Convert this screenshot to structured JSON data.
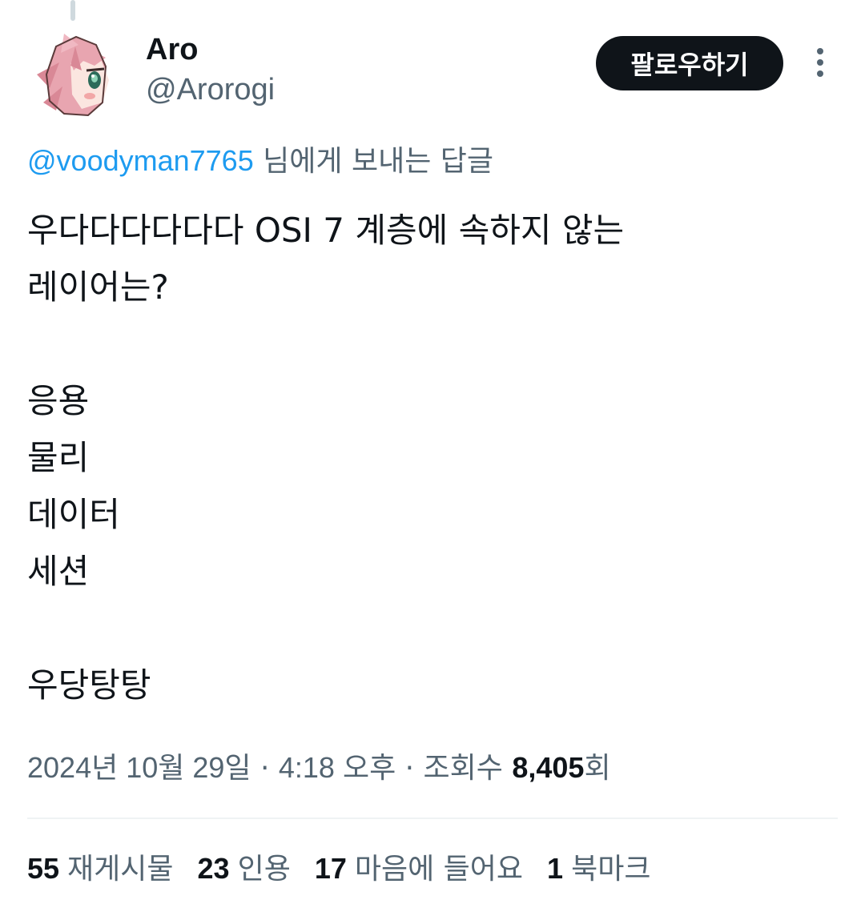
{
  "author": {
    "display_name": "Aro",
    "handle": "@Arorogi",
    "avatar_icon": "anime-character-avatar"
  },
  "header": {
    "follow_label": "팔로우하기",
    "more_icon": "more-vertical-icon"
  },
  "reply": {
    "mention": "@voodyman7765",
    "suffix": " 님에게 보내는 답글"
  },
  "tweet": {
    "lines": [
      "우다다다다다다 OSI 7 계층에 속하지 않는",
      "레이어는?",
      "",
      "응용",
      "물리",
      "데이터",
      "세션",
      "",
      "우당탕탕"
    ]
  },
  "meta": {
    "date": "2024년 10월 29일",
    "separator": " · ",
    "time": "4:18 오후",
    "views_label": "조회수 ",
    "views_count": "8,405",
    "views_suffix": "회"
  },
  "stats": {
    "retweets_count": "55",
    "retweets_label": "재게시물",
    "quotes_count": "23",
    "quotes_label": "인용",
    "likes_count": "17",
    "likes_label": "마음에 들어요",
    "bookmarks_count": "1",
    "bookmarks_label": "북마크"
  },
  "colors": {
    "text_primary": "#0f1419",
    "text_secondary": "#536471",
    "link": "#1d9bf0",
    "button_bg": "#0f1419",
    "divider": "#eff3f4"
  }
}
